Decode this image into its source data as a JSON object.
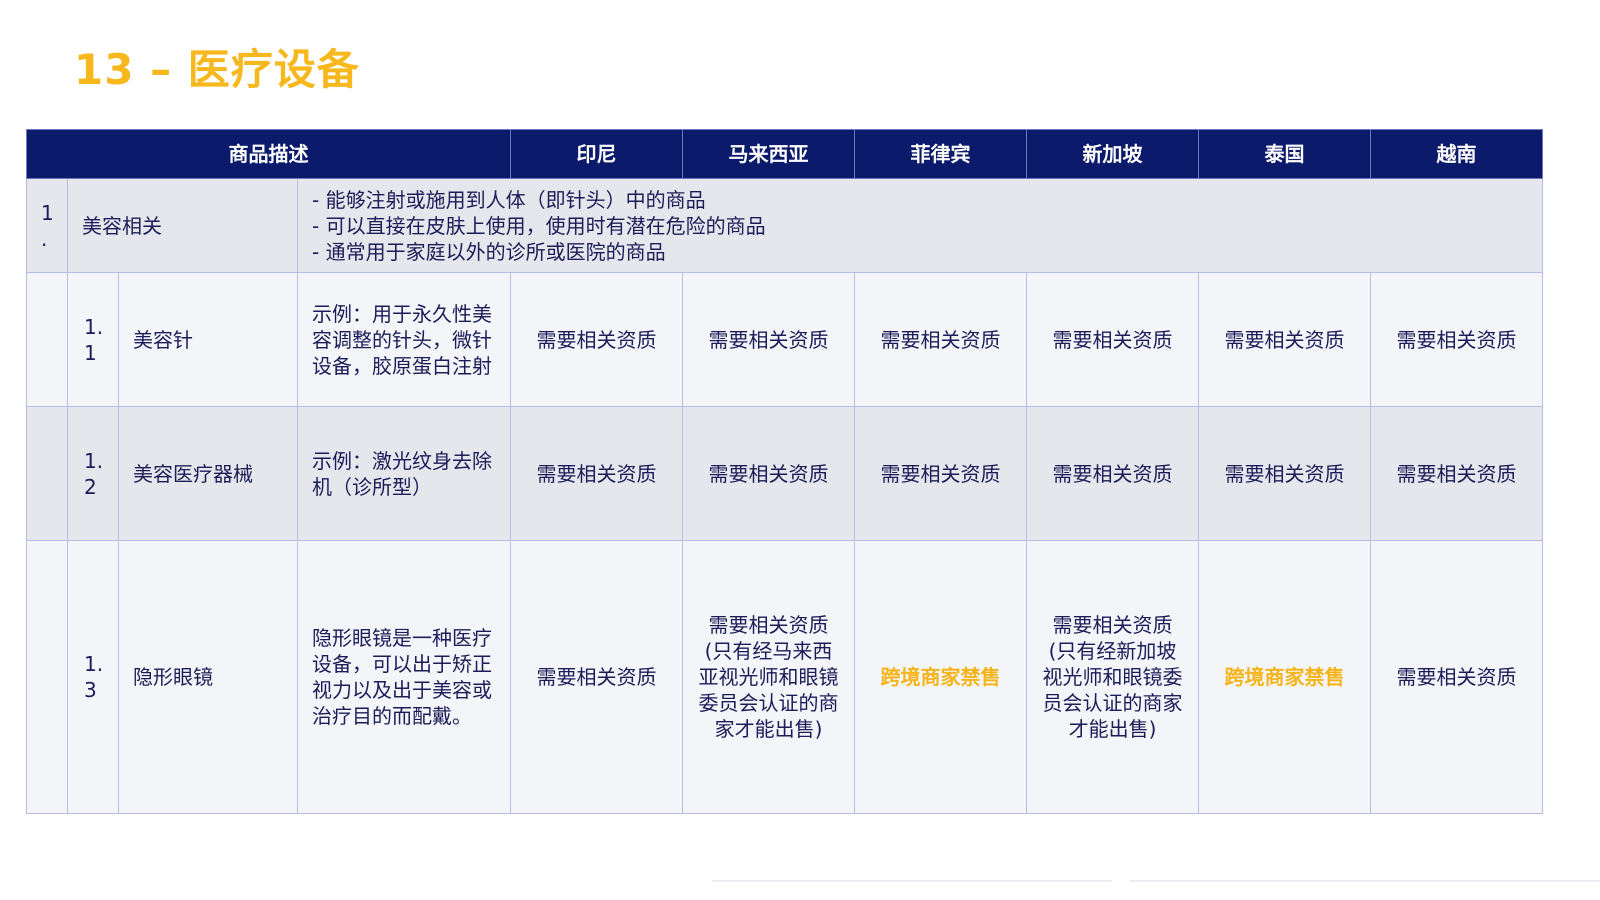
{
  "page": {
    "title": "13 – 医疗设备"
  },
  "colors": {
    "title": "#f6b81c",
    "header_bg": "#0c1a6b",
    "text": "#1c1c59",
    "banned_text": "#f4b41a",
    "category_row_bg": "#e6e7ec",
    "item_row_bg": "#f4f5f9",
    "border": "#b9bde6"
  },
  "table": {
    "headers": {
      "description": "商品描述",
      "countries": [
        "印尼",
        "马来西亚",
        "菲律宾",
        "新加坡",
        "泰国",
        "越南"
      ]
    },
    "category": {
      "number": "1\n.",
      "name": "美容相关",
      "notes": [
        "- 能够注射或施用到人体（即针头）中的商品",
        "- 可以直接在皮肤上使用，使用时有潜在危险的商品",
        "- 通常用于家庭以外的诊所或医院的商品"
      ]
    },
    "items": [
      {
        "number": "1.\n1",
        "name": "美容针",
        "description": "示例：用于永久性美容调整的针头，微针设备，胶原蛋白注射",
        "statuses": [
          {
            "text": "需要相关资质",
            "banned": false
          },
          {
            "text": "需要相关资质",
            "banned": false
          },
          {
            "text": "需要相关资质",
            "banned": false
          },
          {
            "text": "需要相关资质",
            "banned": false
          },
          {
            "text": "需要相关资质",
            "banned": false
          },
          {
            "text": "需要相关资质",
            "banned": false
          }
        ]
      },
      {
        "number": "1.\n2",
        "name": "美容医疗器械",
        "description": "示例：激光纹身去除机（诊所型）",
        "statuses": [
          {
            "text": "需要相关资质",
            "banned": false
          },
          {
            "text": "需要相关资质",
            "banned": false
          },
          {
            "text": "需要相关资质",
            "banned": false
          },
          {
            "text": "需要相关资质",
            "banned": false
          },
          {
            "text": "需要相关资质",
            "banned": false
          },
          {
            "text": "需要相关资质",
            "banned": false
          }
        ]
      },
      {
        "number": "1.\n3",
        "name": "隐形眼镜",
        "description": "隐形眼镜是一种医疗设备，可以出于矫正视力以及出于美容或治疗目的而配戴。",
        "statuses": [
          {
            "text": "需要相关资质",
            "banned": false
          },
          {
            "text": "需要相关资质(只有经马来西亚视光师和眼镜委员会认证的商家才能出售)",
            "banned": false
          },
          {
            "text": "跨境商家禁售",
            "banned": true
          },
          {
            "text": "需要相关资质(只有经新加坡视光师和眼镜委员会认证的商家才能出售)",
            "banned": false
          },
          {
            "text": "跨境商家禁售",
            "banned": true
          },
          {
            "text": "需要相关资质",
            "banned": false
          }
        ]
      }
    ]
  }
}
